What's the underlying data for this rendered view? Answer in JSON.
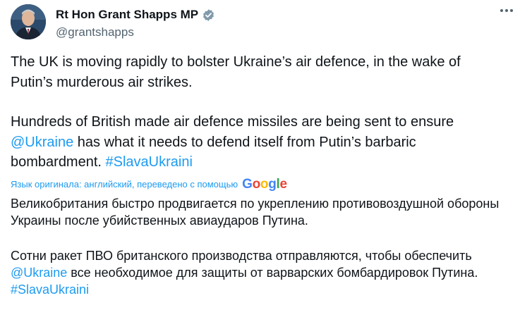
{
  "author": {
    "display_name": "Rt Hon Grant Shapps MP",
    "handle": "@grantshapps",
    "verified": true,
    "avatar_icon": "profile-photo",
    "verified_icon": "verified-badge-icon"
  },
  "menu": {
    "more_icon": "more-options-icon"
  },
  "tweet": {
    "para1": "The UK is moving rapidly to bolster Ukraine’s air defence, in the wake of Putin’s murderous air strikes.",
    "para2_before": "Hundreds of British made air defence missiles are being sent to ensure ",
    "para2_mention": "@Ukraine",
    "para2_after": " has what it needs to defend itself from Putin’s barbaric bombardment. ",
    "para2_hashtag": "#SlavaUkraini"
  },
  "translation": {
    "label": "Язык оригинала: английский, переведено с помощью",
    "provider": "Google",
    "para1": "Великобритания быстро продвигается по укреплению противовоздушной обороны Украины после убийственных авиаударов Путина.",
    "para2_before": "Сотни ракет ПВО британского производства отправляются, чтобы обеспечить ",
    "para2_mention": "@Ukraine",
    "para2_after": " все необходимое для защиты от варварских бомбардировок Путина. ",
    "para2_hashtag": "#SlavaUkraini"
  },
  "colors": {
    "link": "#1d9bf0",
    "text": "#0f1419",
    "secondary": "#536471"
  }
}
